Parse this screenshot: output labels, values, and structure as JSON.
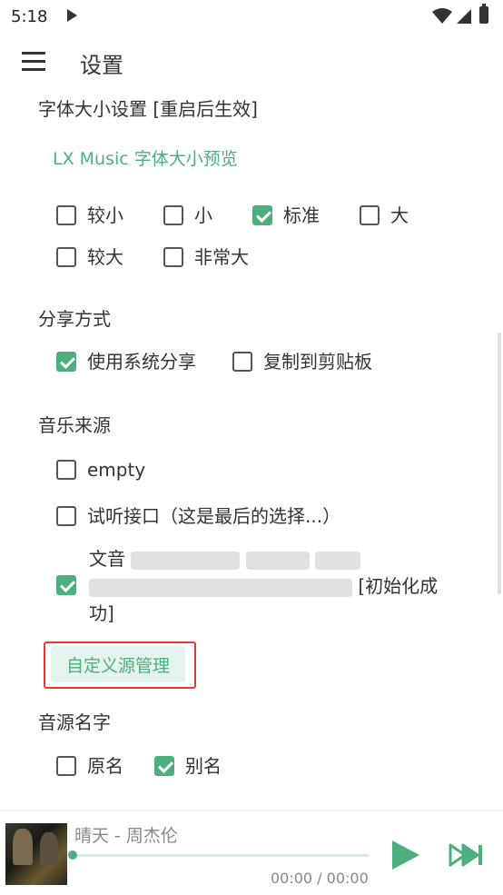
{
  "status_bar": {
    "time": "5:18"
  },
  "header": {
    "title": "设置"
  },
  "font_size": {
    "title": "字体大小设置 [重启后生效]",
    "preview": "LX Music 字体大小预览",
    "options": [
      {
        "label": "较小",
        "checked": false
      },
      {
        "label": "小",
        "checked": false
      },
      {
        "label": "标准",
        "checked": true
      },
      {
        "label": "大",
        "checked": false
      },
      {
        "label": "较大",
        "checked": false
      },
      {
        "label": "非常大",
        "checked": false
      }
    ]
  },
  "share": {
    "title": "分享方式",
    "options": [
      {
        "label": "使用系统分享",
        "checked": true
      },
      {
        "label": "复制到剪贴板",
        "checked": false
      }
    ]
  },
  "music_source": {
    "title": "音乐来源",
    "options": [
      {
        "label": "empty",
        "checked": false
      },
      {
        "label": "试听接口（这是最后的选择...）",
        "checked": false
      },
      {
        "line1": "文音",
        "line2_end": "[初始化成",
        "line3": "功]",
        "checked": true
      }
    ],
    "custom_button": "自定义源管理"
  },
  "source_name": {
    "title": "音源名字",
    "options": [
      {
        "label": "原名",
        "checked": false
      },
      {
        "label": "别名",
        "checked": true
      }
    ]
  },
  "player": {
    "song": "晴天 - 周杰伦",
    "time": "00:00 / 00:00",
    "progress": 0.0
  },
  "colors": {
    "accent": "#4caf7d",
    "highlight_frame": "#e53935"
  }
}
